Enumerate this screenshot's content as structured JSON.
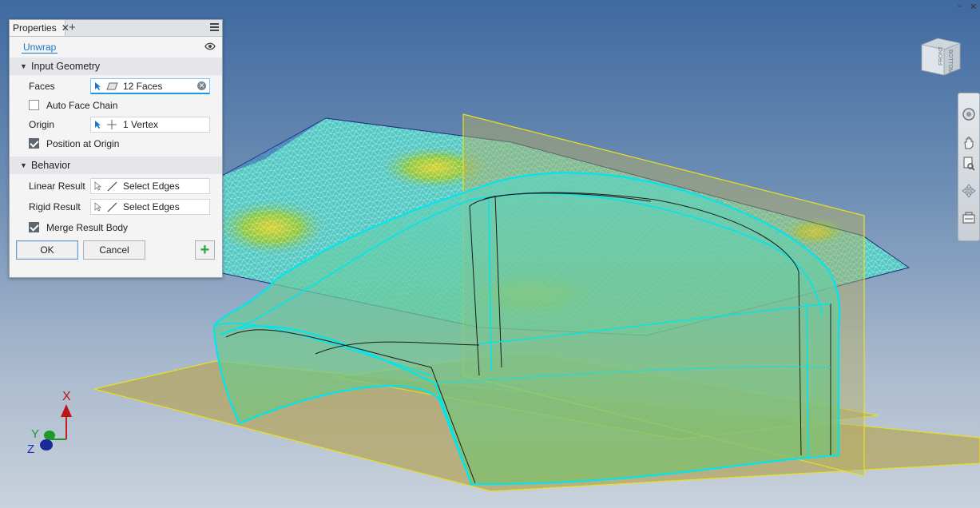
{
  "panel": {
    "tab_title": "Properties",
    "tab_close": "✕",
    "tab_add": "+",
    "command_link": "Unwrap",
    "sections": {
      "input_geometry": "Input Geometry",
      "behavior": "Behavior"
    },
    "faces": {
      "label": "Faces",
      "value": "12 Faces"
    },
    "auto_face_chain": {
      "label": "Auto Face Chain",
      "checked": false
    },
    "origin": {
      "label": "Origin",
      "value": "1 Vertex"
    },
    "position_at_origin": {
      "label": "Position at Origin",
      "checked": true
    },
    "linear_result": {
      "label": "Linear Result",
      "value": "Select Edges"
    },
    "rigid_result": {
      "label": "Rigid Result",
      "value": "Select Edges"
    },
    "merge_result_body": {
      "label": "Merge Result Body",
      "checked": true
    },
    "buttons": {
      "ok": "OK",
      "cancel": "Cancel",
      "add": "+"
    }
  },
  "viewcube": {
    "front": "FRONT",
    "bottom": "BOTTOM"
  },
  "triad": {
    "x": "X",
    "y": "Y",
    "z": "Z"
  },
  "colors": {
    "accent": "#1a78c8",
    "plane_edge": "#e8e020",
    "surface_outline": "#00e5ee",
    "mesh_wire": "#ffffff"
  },
  "icons": [
    "close-icon",
    "add-tab-icon",
    "menu-icon",
    "eye-icon",
    "select-arrow-icon",
    "face-icon",
    "clear-icon",
    "vertex-icon",
    "edge-icon",
    "orbit-icon",
    "pan-icon",
    "zoom-icon",
    "look-icon",
    "view-icon"
  ]
}
